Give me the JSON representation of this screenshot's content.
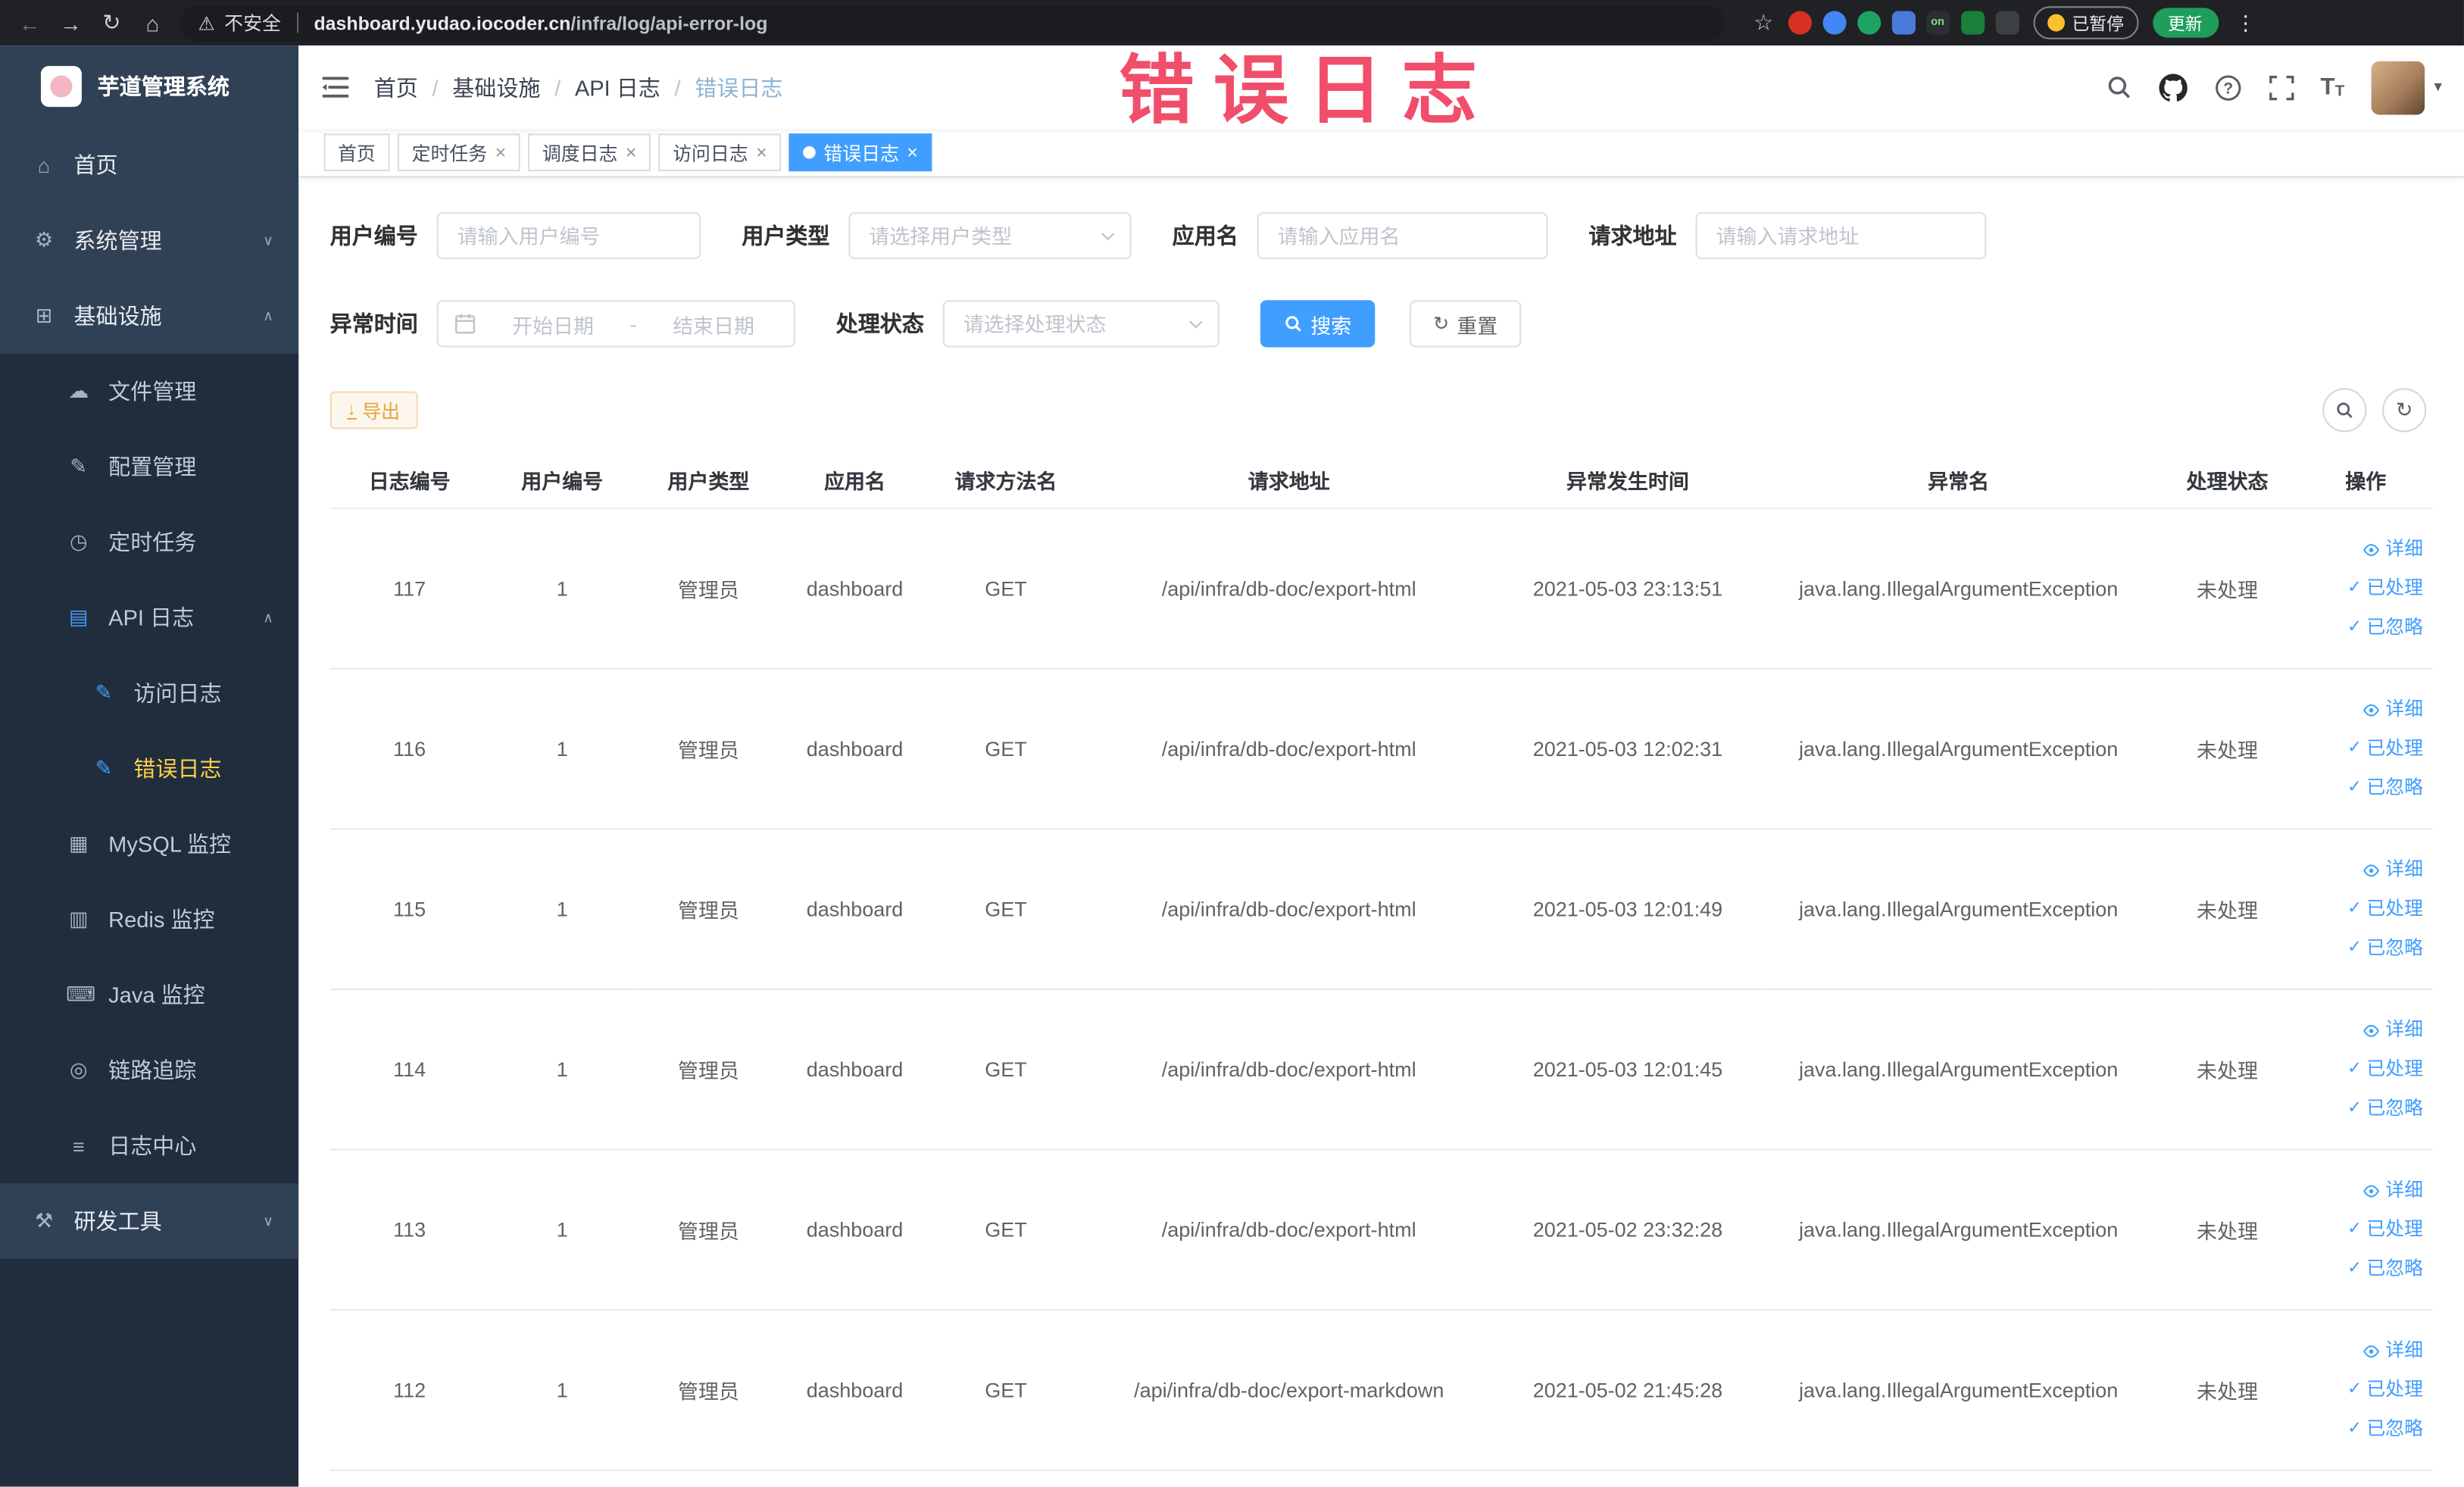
{
  "browser": {
    "security_label": "不安全",
    "url_domain": "dashboard.yudao.iocoder.cn",
    "url_path": "/infra/log/api-error-log",
    "paused_badge": "已暂停",
    "update_label": "更新",
    "extensions": [
      {
        "id": "extension-red-circle",
        "color": "#d93025",
        "shape": "circle",
        "text": ""
      },
      {
        "id": "extension-blue-drop",
        "color": "#4285f4",
        "shape": "circle",
        "text": ""
      },
      {
        "id": "extension-green-circle",
        "color": "#1ea362",
        "shape": "circle",
        "text": ""
      },
      {
        "id": "extension-blue-grid",
        "color": "#4a7bd8",
        "shape": "square",
        "text": ""
      },
      {
        "id": "extension-on-badge",
        "color": "#2b2e33",
        "shape": "square",
        "text": "on",
        "text_color": "#7ee081"
      },
      {
        "id": "extension-green-leaf",
        "color": "#188038",
        "shape": "square",
        "text": ""
      },
      {
        "id": "extension-dark-paw",
        "color": "#3c4043",
        "shape": "square",
        "text": ""
      }
    ]
  },
  "overlay": {
    "title": "错误日志",
    "color": "#f14e6b"
  },
  "sidebar": {
    "logo_title": "芋道管理系统",
    "menu": [
      {
        "id": "home",
        "label": "首页",
        "icon": "home-icon",
        "level": 1
      },
      {
        "id": "system-mgmt",
        "label": "系统管理",
        "icon": "gear-icon",
        "level": 1,
        "arrow": "down"
      },
      {
        "id": "infrastructure",
        "label": "基础设施",
        "icon": "infra-icon",
        "level": 1,
        "arrow": "up"
      },
      {
        "id": "file-mgmt",
        "label": "文件管理",
        "icon": "cloud-icon",
        "level": 2
      },
      {
        "id": "config-mgmt",
        "label": "配置管理",
        "icon": "edit-icon",
        "level": 2
      },
      {
        "id": "scheduled-tasks",
        "label": "定时任务",
        "icon": "clock-icon",
        "level": 2
      },
      {
        "id": "api-log",
        "label": "API 日志",
        "icon": "log-icon",
        "level": 2,
        "arrow": "up",
        "blue": true
      },
      {
        "id": "access-log",
        "label": "访问日志",
        "icon": "doc-icon",
        "level": 3,
        "blue": true
      },
      {
        "id": "error-log",
        "label": "错误日志",
        "icon": "doc-icon",
        "level": 3,
        "blue": true,
        "active": true
      },
      {
        "id": "mysql-monitor",
        "label": "MySQL 监控",
        "icon": "database-icon",
        "level": 2
      },
      {
        "id": "redis-monitor",
        "label": "Redis 监控",
        "icon": "storage-icon",
        "level": 2
      },
      {
        "id": "java-monitor",
        "label": "Java 监控",
        "icon": "monitor-icon",
        "level": 2
      },
      {
        "id": "link-trace",
        "label": "链路追踪",
        "icon": "eye-icon",
        "level": 2
      },
      {
        "id": "log-center",
        "label": "日志中心",
        "icon": "list-icon",
        "level": 2
      },
      {
        "id": "dev-tools",
        "label": "研发工具",
        "icon": "tools-icon",
        "level": 1,
        "arrow": "down"
      }
    ]
  },
  "breadcrumb": [
    "首页",
    "基础设施",
    "API 日志",
    "错误日志"
  ],
  "tags": [
    {
      "id": "home",
      "label": "首页",
      "closable": false,
      "active": false
    },
    {
      "id": "scheduled-job",
      "label": "定时任务",
      "closable": true,
      "active": false
    },
    {
      "id": "job-log",
      "label": "调度日志",
      "closable": true,
      "active": false
    },
    {
      "id": "access-log",
      "label": "访问日志",
      "closable": true,
      "active": false
    },
    {
      "id": "error-log",
      "label": "错误日志",
      "closable": true,
      "active": true
    }
  ],
  "filters": {
    "user_id": {
      "label": "用户编号",
      "placeholder": "请输入用户编号"
    },
    "user_type": {
      "label": "用户类型",
      "placeholder": "请选择用户类型"
    },
    "app_name": {
      "label": "应用名",
      "placeholder": "请输入应用名"
    },
    "request_url": {
      "label": "请求地址",
      "placeholder": "请输入请求地址"
    },
    "exception_time": {
      "label": "异常时间",
      "start_placeholder": "开始日期",
      "separator": "-",
      "end_placeholder": "结束日期"
    },
    "process_status": {
      "label": "处理状态",
      "placeholder": "请选择处理状态"
    },
    "search_label": "搜索",
    "reset_label": "重置"
  },
  "toolbar": {
    "export_label": "导出"
  },
  "table": {
    "headers": [
      "日志编号",
      "用户编号",
      "用户类型",
      "应用名",
      "请求方法名",
      "请求地址",
      "异常发生时间",
      "异常名",
      "处理状态",
      "操作"
    ],
    "actions": [
      "详细",
      "已处理",
      "已忽略"
    ],
    "rows": [
      {
        "id": "117",
        "user_id": "1",
        "user_type": "管理员",
        "app": "dashboard",
        "method": "GET",
        "url": "/api/infra/db-doc/export-html",
        "time": "2021-05-03 23:13:51",
        "exception": "java.lang.IllegalArgumentException",
        "status": "未处理"
      },
      {
        "id": "116",
        "user_id": "1",
        "user_type": "管理员",
        "app": "dashboard",
        "method": "GET",
        "url": "/api/infra/db-doc/export-html",
        "time": "2021-05-03 12:02:31",
        "exception": "java.lang.IllegalArgumentException",
        "status": "未处理"
      },
      {
        "id": "115",
        "user_id": "1",
        "user_type": "管理员",
        "app": "dashboard",
        "method": "GET",
        "url": "/api/infra/db-doc/export-html",
        "time": "2021-05-03 12:01:49",
        "exception": "java.lang.IllegalArgumentException",
        "status": "未处理"
      },
      {
        "id": "114",
        "user_id": "1",
        "user_type": "管理员",
        "app": "dashboard",
        "method": "GET",
        "url": "/api/infra/db-doc/export-html",
        "time": "2021-05-03 12:01:45",
        "exception": "java.lang.IllegalArgumentException",
        "status": "未处理"
      },
      {
        "id": "113",
        "user_id": "1",
        "user_type": "管理员",
        "app": "dashboard",
        "method": "GET",
        "url": "/api/infra/db-doc/export-html",
        "time": "2021-05-02 23:32:28",
        "exception": "java.lang.IllegalArgumentException",
        "status": "未处理"
      },
      {
        "id": "112",
        "user_id": "1",
        "user_type": "管理员",
        "app": "dashboard",
        "method": "GET",
        "url": "/api/infra/db-doc/export-markdown",
        "time": "2021-05-02 21:45:28",
        "exception": "java.lang.IllegalArgumentException",
        "status": "未处理"
      }
    ]
  },
  "colors": {
    "accent": "#409eff",
    "active_menu_text": "#ffd04b",
    "warning": "#e6a23c",
    "sidebar_bg": "#304156",
    "submenu_bg": "#1f2d3d"
  }
}
